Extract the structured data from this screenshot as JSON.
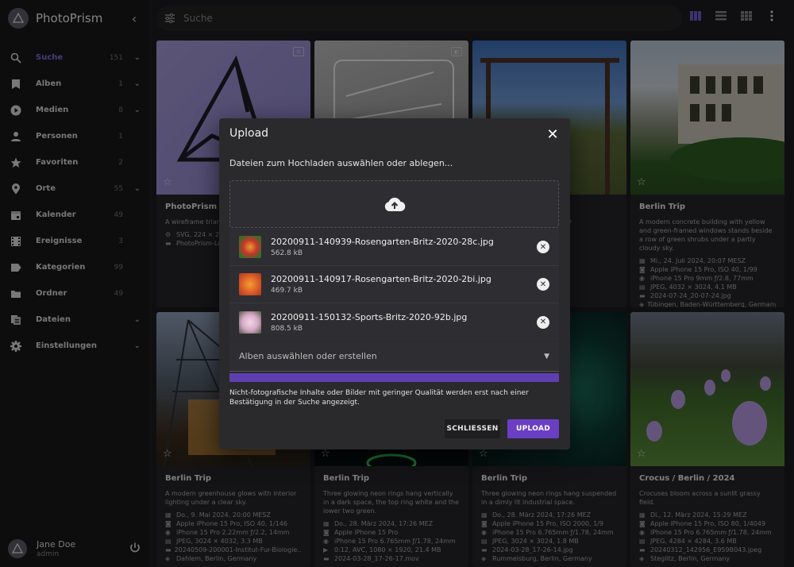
{
  "app": {
    "name": "PhotoPrism"
  },
  "sidebar": {
    "items": [
      {
        "label": "Suche",
        "count": "151",
        "chevron": true,
        "active": true,
        "icon": "search-icon"
      },
      {
        "label": "Alben",
        "count": "1",
        "chevron": true,
        "icon": "bookmark-icon"
      },
      {
        "label": "Medien",
        "count": "8",
        "chevron": true,
        "icon": "play-circle-icon"
      },
      {
        "label": "Personen",
        "count": "1",
        "chevron": false,
        "icon": "person-icon"
      },
      {
        "label": "Favoriten",
        "count": "2",
        "chevron": false,
        "icon": "star-icon"
      },
      {
        "label": "Orte",
        "count": "55",
        "chevron": true,
        "icon": "map-pin-icon"
      },
      {
        "label": "Kalender",
        "count": "49",
        "chevron": false,
        "icon": "calendar-icon"
      },
      {
        "label": "Ereignisse",
        "count": "3",
        "chevron": false,
        "icon": "film-icon"
      },
      {
        "label": "Kategorien",
        "count": "99",
        "chevron": false,
        "icon": "label-icon"
      },
      {
        "label": "Ordner",
        "count": "49",
        "chevron": false,
        "icon": "folder-icon"
      },
      {
        "label": "Dateien",
        "count": "",
        "chevron": true,
        "icon": "files-icon"
      },
      {
        "label": "Einstellungen",
        "count": "",
        "chevron": true,
        "icon": "gear-icon"
      }
    ],
    "user": {
      "name": "Jane Doe",
      "role": "admin"
    }
  },
  "search": {
    "placeholder": "Suche"
  },
  "colors": {
    "accent": "#6a3fc4",
    "active_nav": "#7e6ee0"
  },
  "cards": [
    {
      "title": "PhotoPrism Lo",
      "desc": "A wireframe trian sional geometric",
      "lines": [
        "SVG, 224 × 22",
        "PhotoPrism-Lo"
      ]
    },
    {
      "title": "",
      "desc": "",
      "lines": []
    },
    {
      "title": "",
      "desc": "columns and to the distance",
      "lines": [
        "MESZ",
        "80, 1/2833",
        "1.78, 24mm",
        "3"
      ]
    },
    {
      "title": "Berlin Trip",
      "desc": "A modern concrete building with yellow and green-framed windows stands beside a row of green shrubs under a partly cloudy sky.",
      "lines": [
        "Mi., 24. Juli 2024, 20:07 MESZ",
        "Apple iPhone 15 Pro, ISO 40, 1/99",
        "iPhone 15 Pro 9mm ƒ/2.8, 77mm",
        "JPEG, 4032 × 3024, 4.1 MB",
        "2024-07-24_20-07-24.jpg",
        "Tübingen, Baden-Württemberg, Germany"
      ]
    },
    {
      "title": "Berlin Trip",
      "desc": "A modern greenhouse glows with interior lighting under a clear sky.",
      "lines": [
        "Do., 9. Mai 2024, 20:00 MESZ",
        "Apple iPhone 15 Pro, ISO 40, 1/146",
        "iPhone 15 Pro 2.22mm ƒ/2.2, 14mm",
        "JPEG, 3024 × 4032, 3.3 MB",
        "20240509-200001-Institut-Fur-Biologie...",
        "Dahlem, Berlin, Germany"
      ]
    },
    {
      "title": "Berlin Trip",
      "desc": "Three glowing neon rings hang vertically in a dark space, the top ring white and the lower two green.",
      "lines": [
        "Do., 28. März 2024, 17:26 MEZ",
        "Apple iPhone 15 Pro",
        "iPhone 15 Pro 6.765mm ƒ/1.78, 24mm",
        "0:12, AVC, 1080 × 1920, 21.4 MB",
        "2024-03-28_17-26-17.mov"
      ]
    },
    {
      "title": "Berlin Trip",
      "desc": "Three glowing neon rings hang suspended in a dimly lit industrial space.",
      "lines": [
        "Do., 28. März 2024, 17:26 MEZ",
        "Apple iPhone 15 Pro, ISO 2000, 1/9",
        "iPhone 15 Pro 6.765mm ƒ/1.78, 24mm",
        "JPEG, 3024 × 3024, 1.8 MB",
        "2024-03-28_17-26-14.jpg",
        "Rummelsburg, Berlin, Germany"
      ]
    },
    {
      "title": "Crocus / Berlin / 2024",
      "desc": "Crocuses bloom across a sunlit grassy field.",
      "lines": [
        "Di., 12. März 2024, 15:29 MEZ",
        "Apple iPhone 15 Pro, ISO 80, 1/4049",
        "iPhone 15 Pro 6.765mm ƒ/1.78, 24mm",
        "JPEG, 4284 × 4284, 3.6 MB",
        "20240312_142956_E959B043.jpeg",
        "Steglitz, Berlin, Germany"
      ]
    }
  ],
  "dialog": {
    "title": "Upload",
    "subtitle": "Dateien zum Hochladen auswählen oder ablegen...",
    "files": [
      {
        "name": "20200911-140939-Rosengarten-Britz-2020-28c.jpg",
        "size": "562.8 kB"
      },
      {
        "name": "20200911-140917-Rosengarten-Britz-2020-2bi.jpg",
        "size": "469.7 kB"
      },
      {
        "name": "20200911-150132-Sports-Britz-2020-92b.jpg",
        "size": "808.5 kB"
      }
    ],
    "album_placeholder": "Alben auswählen oder erstellen",
    "progress": 1.0,
    "note": "Nicht-fotografische Inhalte oder Bilder mit geringer Qualität werden erst nach einer Bestätigung in der Suche angezeigt.",
    "close_label": "SCHLIESSEN",
    "upload_label": "UPLOAD"
  }
}
